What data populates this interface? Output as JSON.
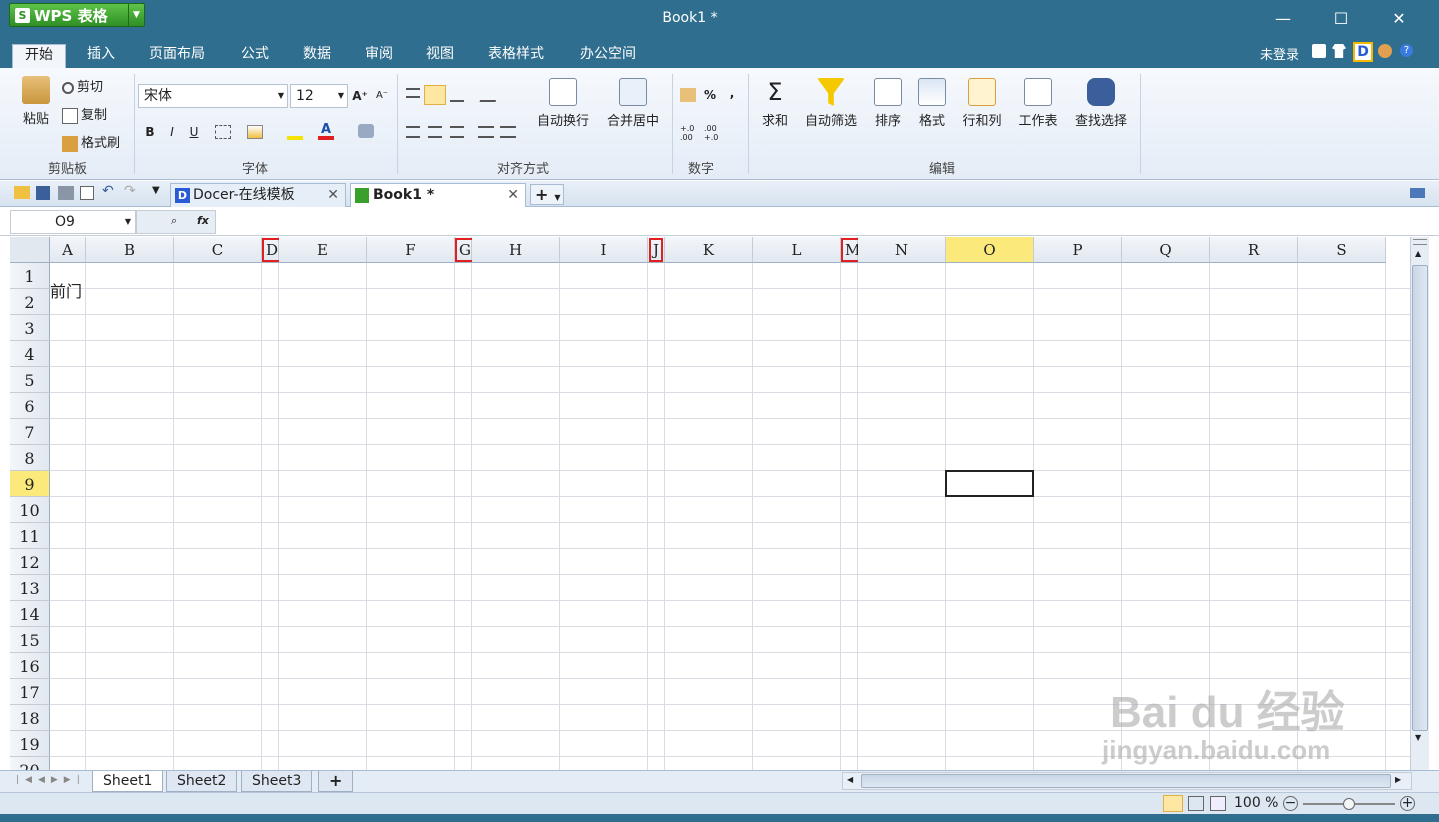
{
  "app": {
    "name": "WPS 表格",
    "window_title": "Book1 *"
  },
  "window_controls": {
    "minimize": "—",
    "maximize": "☐",
    "close": "✕"
  },
  "menu": {
    "tabs": [
      "开始",
      "插入",
      "页面布局",
      "公式",
      "数据",
      "审阅",
      "视图",
      "表格样式",
      "办公空间"
    ],
    "login": "未登录",
    "icons": [
      "up-icon",
      "shirt-icon",
      "docer-icon",
      "person-icon",
      "help-icon"
    ]
  },
  "ribbon": {
    "clipboard": {
      "paste": "粘贴",
      "cut": "剪切",
      "copy": "复制",
      "format_painter": "格式刷",
      "group": "剪贴板"
    },
    "font": {
      "name": "宋体",
      "size": "12",
      "grow": "A⁺",
      "shrink": "A⁻",
      "bold": "B",
      "italic": "I",
      "underline": "U",
      "group": "字体"
    },
    "align": {
      "wrap": "自动换行",
      "merge": "合并居中",
      "group": "对齐方式"
    },
    "number": {
      "percent": "%",
      "comma": ",",
      "inc_decimal": "+.0 .00",
      "dec_decimal": ".00 +.0",
      "group": "数字"
    },
    "edit": {
      "sum": "求和",
      "filter": "自动筛选",
      "sort": "排序",
      "format": "格式",
      "rowcol": "行和列",
      "sheet": "工作表",
      "find": "查找选择",
      "group": "编辑"
    }
  },
  "doc_tabs": [
    {
      "label": "Docer-在线模板"
    },
    {
      "label": "Book1 *"
    }
  ],
  "doc_tab_add": "+",
  "formula_bar": {
    "name_box": "O9",
    "fx": "fx",
    "formula": ""
  },
  "grid": {
    "columns": [
      "A",
      "B",
      "C",
      "D",
      "E",
      "F",
      "G",
      "H",
      "I",
      "J",
      "K",
      "L",
      "M",
      "N",
      "O",
      "P",
      "Q",
      "R",
      "S"
    ],
    "marked_columns": [
      "D",
      "G",
      "J",
      "M"
    ],
    "selected_column": "O",
    "rows": [
      "1",
      "2",
      "3",
      "4",
      "5",
      "6",
      "7",
      "8",
      "9",
      "10",
      "11",
      "12",
      "13",
      "14",
      "15",
      "16",
      "17",
      "18",
      "19",
      "20"
    ],
    "selected_row": "9",
    "cells": {
      "A2": "前门"
    },
    "active_cell": "O9"
  },
  "sheets": [
    {
      "label": "Sheet1"
    },
    {
      "label": "Sheet2"
    },
    {
      "label": "Sheet3"
    }
  ],
  "sheet_add": "+",
  "status": {
    "zoom": "100 %",
    "zoom_level": 0.5
  },
  "watermark": {
    "brand": "Bai du 经验",
    "url": "jingyan.baidu.com"
  },
  "colors": {
    "title_bar": "#2f6e8e",
    "selected_header": "#fbe97c",
    "marker_red": "#e02020",
    "wps_green": "#3aa02c"
  }
}
